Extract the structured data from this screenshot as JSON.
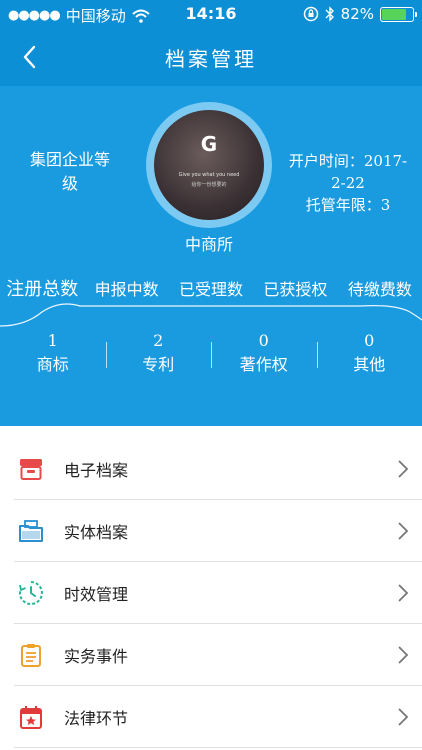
{
  "status_bar": {
    "carrier": "中国移动",
    "time": "14:16",
    "battery_percent": "82%",
    "battery_level": 0.82,
    "battery_color": "#57d35a"
  },
  "nav": {
    "title": "档案管理",
    "back_icon": "chevron-left-icon"
  },
  "profile": {
    "company_type": "集团企业等级",
    "company_name": "中商所",
    "avatar": {
      "letter": "G",
      "tagline_en": "Give you what you need",
      "tagline_cn": "给你一份想要的"
    },
    "open_time_label": "开户时间：",
    "open_time_value": "2017-2-22",
    "custody_label": "托管年限：",
    "custody_value": "3"
  },
  "tabs": [
    {
      "label": "注册总数",
      "active": true
    },
    {
      "label": "申报中数",
      "active": false
    },
    {
      "label": "已受理数",
      "active": false
    },
    {
      "label": "已获授权",
      "active": false
    },
    {
      "label": "待缴费数",
      "active": false
    }
  ],
  "stats": [
    {
      "value": "1",
      "label": "商标"
    },
    {
      "value": "2",
      "label": "专利"
    },
    {
      "value": "0",
      "label": "著作权"
    },
    {
      "value": "0",
      "label": "其他"
    }
  ],
  "menu": [
    {
      "label": "电子档案",
      "icon": "archive-box-icon",
      "color": "#e84a4a"
    },
    {
      "label": "实体档案",
      "icon": "folder-icon",
      "color": "#2b8fd1"
    },
    {
      "label": "时效管理",
      "icon": "clock-icon",
      "color": "#27b497"
    },
    {
      "label": "实务事件",
      "icon": "clipboard-icon",
      "color": "#f0a12a"
    },
    {
      "label": "法律环节",
      "icon": "calendar-star-icon",
      "color": "#e23a3a"
    }
  ],
  "colors": {
    "primary": "#0d8fd6",
    "panel": "#1a9be0"
  }
}
